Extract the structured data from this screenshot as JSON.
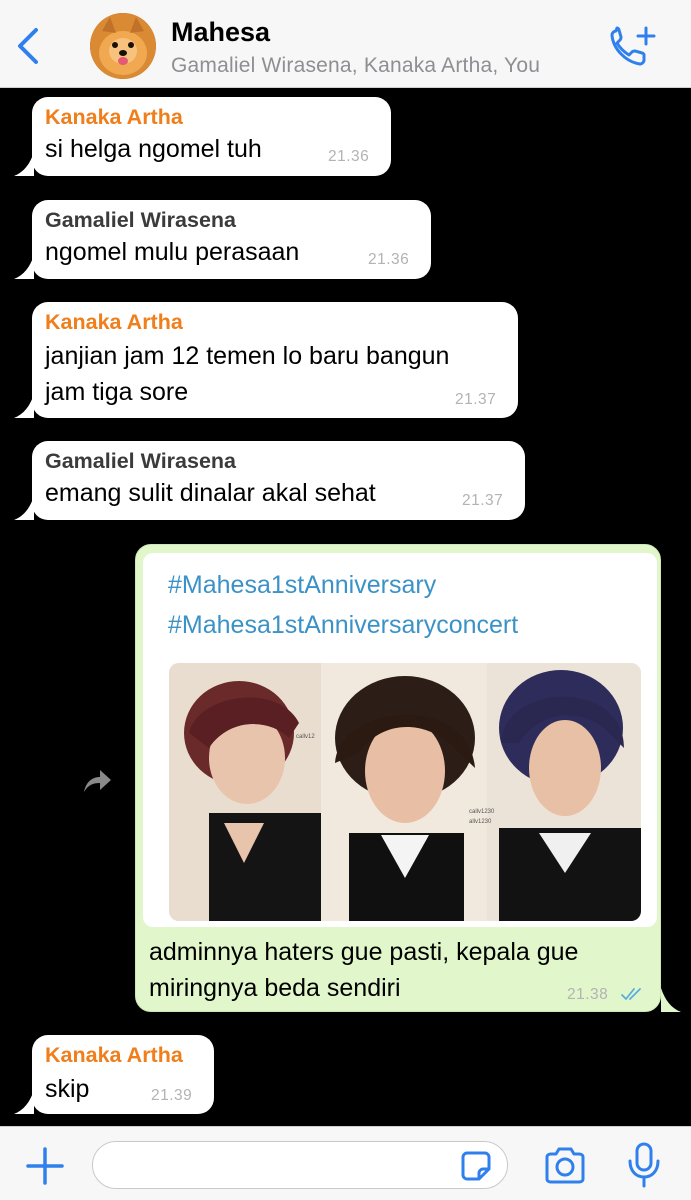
{
  "header": {
    "title": "Mahesa",
    "subtitle": "Gamaliel Wirasena, Kanaka Artha, You"
  },
  "messages": [
    {
      "sender": "Kanaka Artha",
      "lines": [
        "si helga ngomel tuh"
      ],
      "time": "21.36"
    },
    {
      "sender": "Gamaliel Wirasena",
      "lines": [
        "ngomel mulu perasaan"
      ],
      "time": "21.36"
    },
    {
      "sender": "Kanaka Artha",
      "lines": [
        "janjian jam 12 temen lo baru bangun",
        "jam tiga sore"
      ],
      "time": "21.37"
    },
    {
      "sender": "Gamaliel Wirasena",
      "lines": [
        "emang sulit dinalar akal sehat"
      ],
      "time": "21.37"
    },
    {
      "sender": "Kanaka Artha",
      "lines": [
        "skip"
      ],
      "time": "21.39"
    }
  ],
  "outgoing": {
    "hashtags": [
      "#Mahesa1stAnniversary",
      "#Mahesa1stAnniversaryconcert"
    ],
    "lines": [
      "adminnya haters gue pasti, kepala gue",
      "miringnya beda sendiri"
    ],
    "time": "21.38",
    "status": "read",
    "photo_watermarks": [
      "callv12",
      "callv1230",
      "allv1230"
    ]
  },
  "input": {
    "placeholder": ""
  },
  "colors": {
    "accent": "#2f80ed",
    "sender_orange": "#ef7e1b",
    "sender_dark": "#3b3b3b",
    "outgoing_bubble": "#e1f7cb",
    "hashtag": "#3b92c7",
    "read_ticks": "#5aaede"
  },
  "icons": [
    "back-chevron-icon",
    "call-add-icon",
    "forward-icon",
    "plus-icon",
    "sticker-icon",
    "camera-icon",
    "microphone-icon",
    "read-receipt-icon"
  ]
}
